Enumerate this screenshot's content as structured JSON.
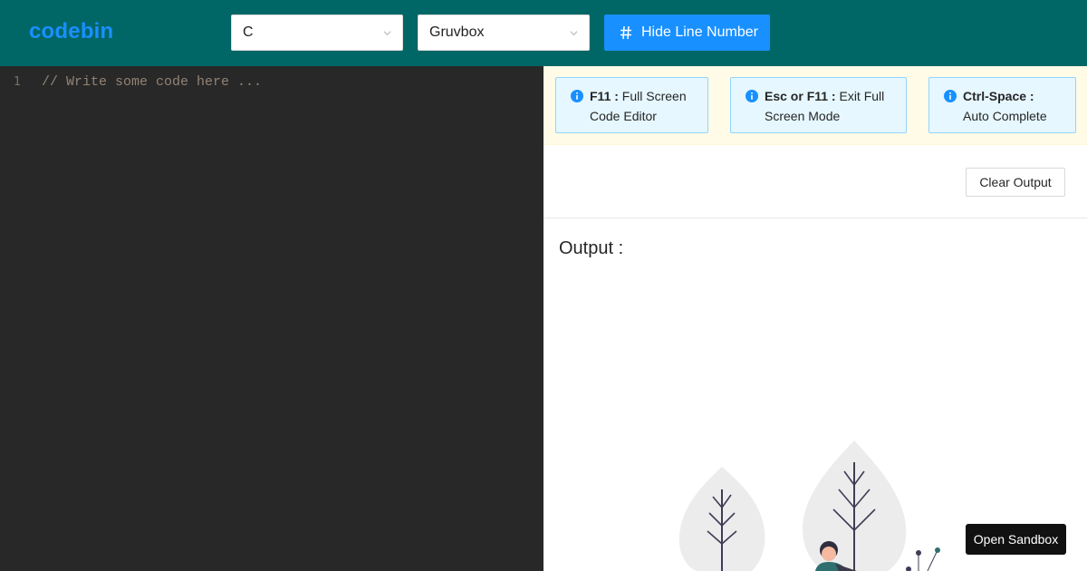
{
  "header": {
    "logo": "codebin",
    "language_select": {
      "value": "C"
    },
    "theme_select": {
      "value": "Gruvbox"
    },
    "toggle_line_numbers_label": "Hide Line Number"
  },
  "editor": {
    "line_number": "1",
    "placeholder_code": "// Write some code here ..."
  },
  "hints": [
    {
      "key": "F11 :",
      "text": " Full Screen Code Editor"
    },
    {
      "key": "Esc or F11 :",
      "text": " Exit Full Screen Mode"
    },
    {
      "key": "Ctrl-Space :",
      "text": " Auto Complete"
    }
  ],
  "output_panel": {
    "clear_label": "Clear Output",
    "title": "Output :",
    "open_sandbox_label": "Open Sandbox"
  },
  "colors": {
    "header_bg": "#006666",
    "accent": "#1890ff",
    "editor_bg": "#282828",
    "hint_bg": "#e6f7ff"
  },
  "icons": [
    "chevron-down-icon",
    "hash-icon",
    "info-icon"
  ]
}
